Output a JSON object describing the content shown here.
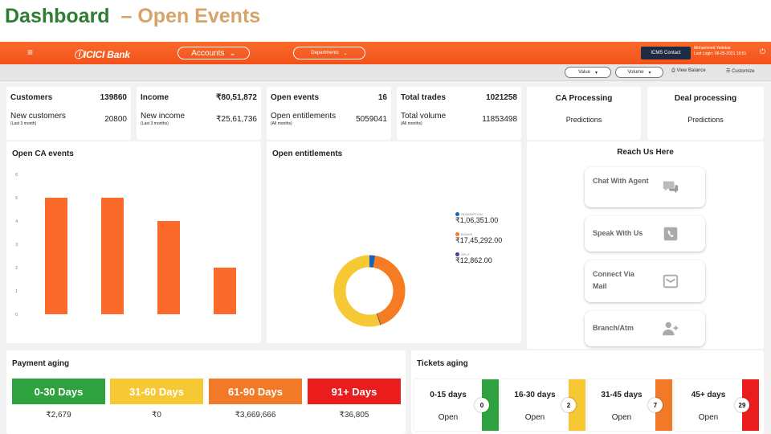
{
  "slide": {
    "title": "Dashboard",
    "subtitle": "– Open Events"
  },
  "nav": {
    "bank_name": "ICICI Bank",
    "accounts_label": "Accounts",
    "departments_label": "Departments",
    "contact_label": "ICMS Contact",
    "user_name": "Mohammed Yedekar",
    "last_login": "Last Login: 06-05-2021 19:51"
  },
  "toolbar": {
    "value_label": "Value",
    "volume_label": "Volume",
    "view_balance": "View Balance",
    "customize": "Customize"
  },
  "kpis": [
    {
      "label": "Customers",
      "value": "139860",
      "sub_label": "New customers",
      "sub_note": "(Last 3 month)",
      "sub_value": "20800"
    },
    {
      "label": "Income",
      "value": "₹80,51,872",
      "sub_label": "New income",
      "sub_note": "(Last 3 months)",
      "sub_value": "₹25,61,736"
    },
    {
      "label": "Open events",
      "value": "16",
      "sub_label": "Open entitlements",
      "sub_note": "(All months)",
      "sub_value": "5059041"
    },
    {
      "label": "Total trades",
      "value": "1021258",
      "sub_label": "Total volume",
      "sub_note": "(All months)",
      "sub_value": "11853498"
    }
  ],
  "predictions": [
    {
      "label": "CA Processing",
      "sub": "Predictions"
    },
    {
      "label": "Deal processing",
      "sub": "Predictions"
    }
  ],
  "open_ca": {
    "title": "Open CA events"
  },
  "open_ent": {
    "title": "Open entitlements",
    "legend": [
      {
        "category": "REDEMPTION",
        "value": "₹1,06,351.00",
        "color": "#1565c0"
      },
      {
        "category": "BONUS",
        "value": "₹17,45,292.00",
        "color": "#f57c22"
      },
      {
        "category": "SPLIT",
        "value": "₹12,862.00",
        "color": "#3f3f9f"
      }
    ]
  },
  "reach": {
    "title": "Reach Us Here",
    "items": [
      {
        "label": "Chat With Agent",
        "icon": "chat-icon"
      },
      {
        "label": "Speak With Us",
        "icon": "phone-icon"
      },
      {
        "label": "Connect Via Mail",
        "icon": "mail-icon"
      },
      {
        "label": "Branch/Atm",
        "icon": "add-user-icon"
      }
    ]
  },
  "payment_aging": {
    "title": "Payment aging",
    "buckets": [
      {
        "label": "0-30 Days",
        "value": "₹2,679",
        "color": "#2ea23f"
      },
      {
        "label": "31-60 Days",
        "value": "₹0",
        "color": "#f6c833"
      },
      {
        "label": "61-90 Days",
        "value": "₹3,669,666",
        "color": "#f07a28"
      },
      {
        "label": "91+ Days",
        "value": "₹36,805",
        "color": "#ea1c1c"
      }
    ]
  },
  "tickets_aging": {
    "title": "Tickets aging",
    "tickets": [
      {
        "label": "0-15 days",
        "status": "Open",
        "count": "0",
        "color": "#2ea23f"
      },
      {
        "label": "16-30 days",
        "status": "Open",
        "count": "2",
        "color": "#f6c833"
      },
      {
        "label": "31-45 days",
        "status": "Open",
        "count": "7",
        "color": "#f07a28"
      },
      {
        "label": "45+ days",
        "status": "Open",
        "count": "29",
        "color": "#ea1c1c"
      }
    ]
  },
  "chart_data": [
    {
      "type": "bar",
      "title": "Open CA events",
      "categories": [
        "",
        "",
        "",
        ""
      ],
      "values": [
        5,
        5,
        4,
        2
      ],
      "ylim": [
        0,
        6
      ],
      "yticks": [
        0,
        1,
        2,
        3,
        4,
        5,
        6
      ],
      "color": "#fb6a2b",
      "grid": false
    },
    {
      "type": "pie",
      "title": "Open entitlements",
      "donut": true,
      "labels": [
        "REDEMPTION",
        "BONUS",
        "SPLIT"
      ],
      "values": [
        106351,
        1745292,
        12862
      ],
      "colors": [
        "#1565c0",
        "#f57c22",
        "#3f3f9f"
      ],
      "background_color": "#f6c833"
    }
  ]
}
